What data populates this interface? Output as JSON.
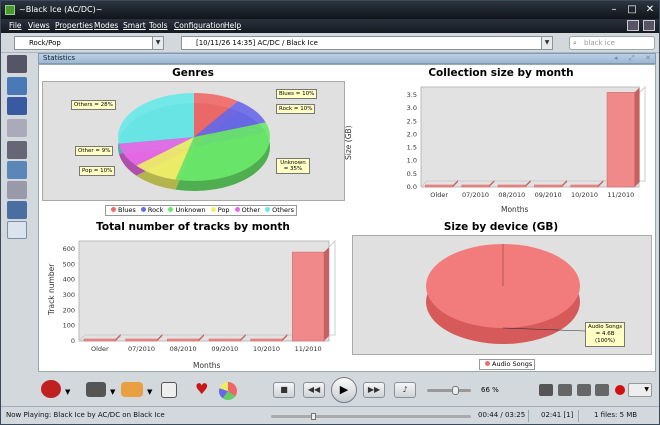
{
  "window": {
    "title": "~Black Ice (AC/DC)~"
  },
  "menu": [
    "File",
    "Views",
    "Properties",
    "Modes",
    "Smart",
    "Tools",
    "Configuration",
    "Help"
  ],
  "toolbar": {
    "genre_combo": "Rock/Pop",
    "track_combo": "[10/11/26 14:35] AC/DC / Black Ice",
    "search_placeholder": "black ice"
  },
  "panel": {
    "title": "Statistics"
  },
  "genres_chart": {
    "title": "Genres",
    "labels": [
      "Blues = 10%",
      "Rock = 10%",
      "Unknown = 35%",
      "Pop = 10%",
      "Other = 9%",
      "Others = 28%"
    ],
    "legend": [
      "Blues",
      "Rock",
      "Unknown",
      "Pop",
      "Other",
      "Others"
    ]
  },
  "collection_chart": {
    "title": "Collection size by month",
    "ylabel": "Size (GB)",
    "xlabel": "Months",
    "yticks": [
      "3.5",
      "3.0",
      "2.5",
      "2.0",
      "1.5",
      "1.0",
      "0.5",
      "0.0"
    ],
    "categories": [
      "Older",
      "07/2010",
      "08/2010",
      "09/2010",
      "10/2010",
      "11/2010"
    ]
  },
  "tracks_chart": {
    "title": "Total number of tracks by month",
    "ylabel": "Track number",
    "xlabel": "Months",
    "yticks": [
      "600",
      "500",
      "400",
      "300",
      "200",
      "100",
      "0"
    ],
    "categories": [
      "Older",
      "07/2010",
      "08/2010",
      "09/2010",
      "10/2010",
      "11/2010"
    ]
  },
  "device_chart": {
    "title": "Size by device (GB)",
    "label_line1": "Audio Songs",
    "label_line2": "= 4.6B",
    "label_line3": "(100%)",
    "legend": "Audio Songs"
  },
  "chart_data": [
    {
      "type": "pie",
      "title": "Genres",
      "categories": [
        "Blues",
        "Rock",
        "Unknown",
        "Pop",
        "Other",
        "Others"
      ],
      "values": [
        10,
        10,
        35,
        10,
        9,
        28
      ],
      "colors": [
        "#f06a6a",
        "#6a6ae8",
        "#6ae86a",
        "#f0f06a",
        "#e86ae8",
        "#6ae8e8"
      ]
    },
    {
      "type": "bar",
      "title": "Collection size by month",
      "categories": [
        "Older",
        "07/2010",
        "08/2010",
        "09/2010",
        "10/2010",
        "11/2010"
      ],
      "values": [
        0,
        0,
        0,
        0,
        0,
        3.6
      ],
      "ylabel": "Size (GB)",
      "xlabel": "Months",
      "ylim": [
        0,
        3.5
      ]
    },
    {
      "type": "bar",
      "title": "Total number of tracks by month",
      "categories": [
        "Older",
        "07/2010",
        "08/2010",
        "09/2010",
        "10/2010",
        "11/2010"
      ],
      "values": [
        0,
        0,
        0,
        0,
        0,
        580
      ],
      "ylabel": "Track number",
      "xlabel": "Months",
      "ylim": [
        0,
        600
      ]
    },
    {
      "type": "pie",
      "title": "Size by device (GB)",
      "categories": [
        "Audio Songs"
      ],
      "values": [
        100
      ]
    }
  ],
  "player": {
    "volume": "66 %",
    "volume_level": 0.66
  },
  "status": {
    "now_playing": "Now Playing:  Black Ice by AC/DC on Black Ice",
    "time": "00:44 / 03:25",
    "position": "02:41 [1]",
    "files": "1 files: 5 MB",
    "progress": 0.21
  }
}
